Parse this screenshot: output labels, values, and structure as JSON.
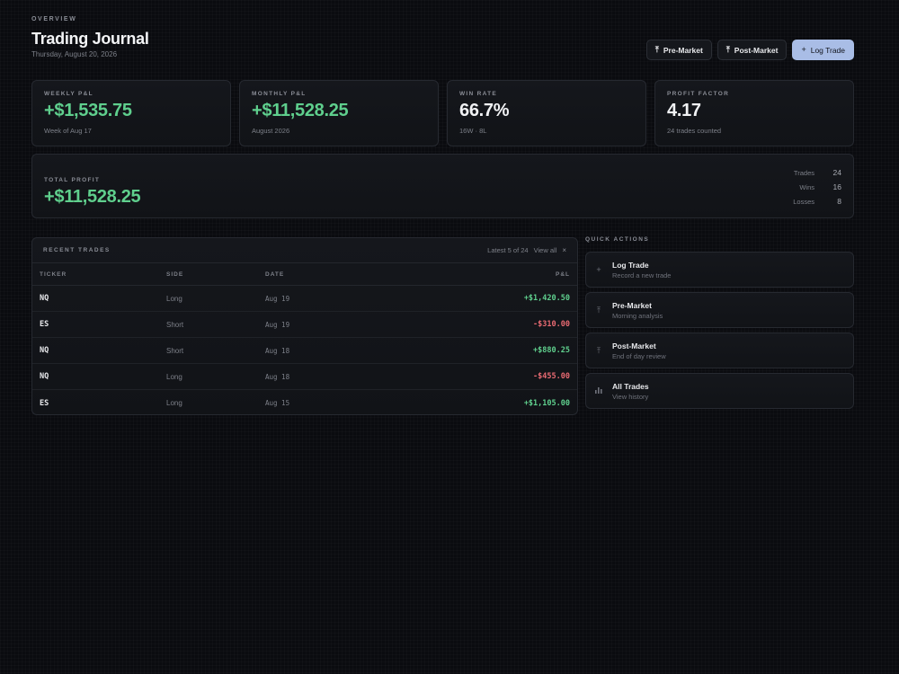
{
  "header": {
    "eyebrow": "OVERVIEW",
    "title": "Trading Journal",
    "date": "Thursday, August 20, 2026",
    "actions": {
      "pre_market": "Pre-Market",
      "post_market": "Post-Market",
      "log_trade": "Log Trade"
    }
  },
  "stats": [
    {
      "label": "WEEKLY P&L",
      "value": "+$1,535.75",
      "sub": "Week of Aug 17"
    },
    {
      "label": "MONTHLY P&L",
      "value": "+$11,528.25",
      "sub": "August 2026"
    },
    {
      "label": "WIN RATE",
      "value": "66.7%",
      "sub": "16W · 8L"
    },
    {
      "label": "PROFIT FACTOR",
      "value": "4.17",
      "sub": "24 trades counted"
    }
  ],
  "total": {
    "label": "TOTAL PROFIT",
    "value": "+$11,528.25",
    "trades_label": "Trades",
    "trades": "24",
    "wins_label": "Wins",
    "wins": "16",
    "losses_label": "Losses",
    "losses": "8"
  },
  "recent": {
    "title": "RECENT TRADES",
    "meta": "Latest 5 of 24",
    "view_all": "View all",
    "close": "×",
    "columns": {
      "ticker": "TICKER",
      "side": "SIDE",
      "date": "DATE",
      "pnl": "P&L"
    },
    "rows": [
      {
        "ticker": "NQ",
        "side": "Long",
        "date": "Aug 19",
        "pnl": "+$1,420.50"
      },
      {
        "ticker": "ES",
        "side": "Short",
        "date": "Aug 19",
        "pnl": "-$310.00"
      },
      {
        "ticker": "NQ",
        "side": "Short",
        "date": "Aug 18",
        "pnl": "+$880.25"
      },
      {
        "ticker": "NQ",
        "side": "Long",
        "date": "Aug 18",
        "pnl": "-$455.00"
      },
      {
        "ticker": "ES",
        "side": "Long",
        "date": "Aug 15",
        "pnl": "+$1,105.00"
      }
    ]
  },
  "quick_actions": {
    "title": "QUICK ACTIONS",
    "items": [
      {
        "title": "Log Trade",
        "sub": "Record a new trade",
        "icon": "plus-icon"
      },
      {
        "title": "Pre-Market",
        "sub": "Morning analysis",
        "icon": "upload-icon"
      },
      {
        "title": "Post-Market",
        "sub": "End of day review",
        "icon": "upload-icon"
      },
      {
        "title": "All Trades",
        "sub": "View history",
        "icon": "bar-chart-icon"
      }
    ]
  },
  "colors": {
    "positive": "#5fcf8d",
    "negative": "#e86a72",
    "accent": "#a9bde6"
  }
}
